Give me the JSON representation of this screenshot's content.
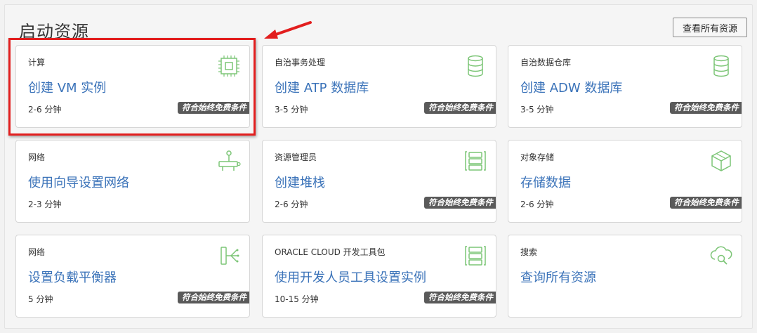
{
  "page": {
    "title": "启动资源",
    "view_all_label": "查看所有资源"
  },
  "badge_label": "符合始终免费条件",
  "cards": [
    {
      "category": "计算",
      "action": "创建 VM 实例",
      "time": "2-6 分钟",
      "icon": "chip-icon"
    },
    {
      "category": "自治事务处理",
      "action": "创建 ATP 数据库",
      "time": "3-5 分钟",
      "icon": "database-icon"
    },
    {
      "category": "自治数据仓库",
      "action": "创建 ADW 数据库",
      "time": "3-5 分钟",
      "icon": "database-icon"
    },
    {
      "category": "网络",
      "action": "使用向导设置网络",
      "time": "2-3 分钟",
      "icon": "network-icon"
    },
    {
      "category": "资源管理员",
      "action": "创建堆栈",
      "time": "2-6 分钟",
      "icon": "stack-icon"
    },
    {
      "category": "对象存储",
      "action": "存储数据",
      "time": "2-6 分钟",
      "icon": "storage-box-icon"
    },
    {
      "category": "网络",
      "action": "设置负载平衡器",
      "time": "5 分钟",
      "icon": "load-balancer-icon"
    },
    {
      "category": "ORACLE CLOUD 开发工具包",
      "action": "使用开发人员工具设置实例",
      "time": "10-15 分钟",
      "icon": "stack-icon"
    },
    {
      "category": "搜索",
      "action": "查询所有资源",
      "time": "",
      "icon": "cloud-search-icon"
    }
  ],
  "colors": {
    "link": "#3b73b9",
    "icon_green": "#7cc576",
    "highlight_red": "#e21e1e",
    "badge_bg": "#5a5a5a"
  }
}
